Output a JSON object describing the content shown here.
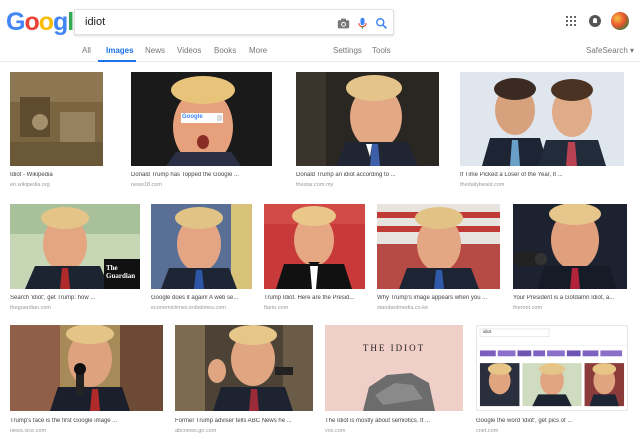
{
  "logo": {
    "letters": [
      "G",
      "o",
      "o",
      "g",
      "l",
      "e"
    ],
    "colors": [
      "#4285F4",
      "#EA4335",
      "#FBBC05",
      "#4285F4",
      "#34A853",
      "#EA4335"
    ]
  },
  "search": {
    "query": "idiot"
  },
  "icons": {
    "camera": "camera-icon",
    "mic": "mic-icon",
    "search": "search-icon",
    "apps": "apps-grid-icon",
    "notifications": "notifications-icon",
    "avatar": "account-avatar"
  },
  "tabs": {
    "all": "All",
    "images": "Images",
    "news": "News",
    "videos": "Videos",
    "books": "Books",
    "more": "More",
    "settings": "Settings",
    "tools": "Tools",
    "safesearch": "SafeSearch"
  },
  "accent_color": "#1a73e8",
  "results": [
    {
      "caption": "Idiot - Wikipedia",
      "source": "en.wikipedia.org"
    },
    {
      "caption": "Donald Trump has Topped the Google ...",
      "source": "news18.com"
    },
    {
      "caption": "Donald Trump an idiot according to ...",
      "source": "thestar.com.my"
    },
    {
      "caption": "If Time Picked a Loser of the Year, It ...",
      "source": "thedailybeast.com"
    },
    {
      "caption": "Search 'idiot', get Trump: how ...",
      "source": "theguardian.com"
    },
    {
      "caption": "Google does it again! A web se...",
      "source": "economictimes.indiatimes.com"
    },
    {
      "caption": "Trump Idiot. Here are the Presid...",
      "source": "ftario.com"
    },
    {
      "caption": "Why Trump's image appears when you ...",
      "source": "standardmedia.co.ke"
    },
    {
      "caption": "Your President is a Gotdamn Idiot, a...",
      "source": "theroot.com"
    },
    {
      "caption": "Trump's face is the first Google image ...",
      "source": "news.vice.com"
    },
    {
      "caption": "Former Trump adviser tells ABC News he ...",
      "source": "abcnews.go.com"
    },
    {
      "caption": "The Idiot is mostly about semiotics. It ...",
      "source": "vox.com"
    },
    {
      "caption": "Google the word 'idiot', get pics of ...",
      "source": "cnet.com"
    }
  ],
  "overlays": {
    "google_search_mock": "Google",
    "guardian_logo": "The Guardian",
    "book_title": "THE IDIOT",
    "mini_query": "idiot"
  }
}
